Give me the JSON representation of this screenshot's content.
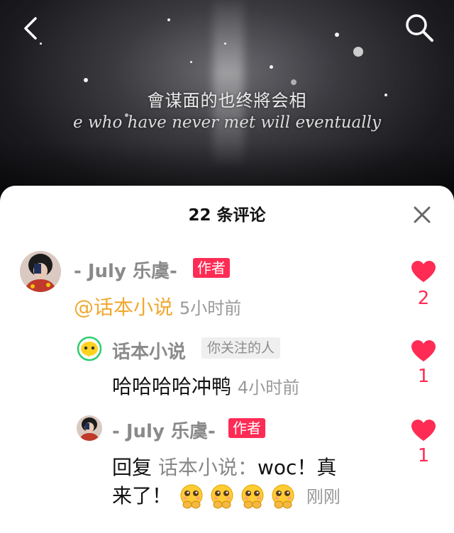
{
  "video": {
    "subtitle_cn": "會谋面的也终將会相",
    "subtitle_en": "e who have never met will eventually"
  },
  "header": {
    "back_icon": "chevron-left-icon",
    "search_icon": "search-icon"
  },
  "comments_panel": {
    "title": "22 条评论",
    "close_icon": "close-icon",
    "comments": [
      {
        "username": "- July 乐虞-",
        "badge": "作者",
        "mention": "@话本小说",
        "text": "",
        "time": "5小时前",
        "likes": "2"
      }
    ],
    "replies": [
      {
        "username": "话本小说",
        "badge": "你关注的人",
        "text": "哈哈哈哈冲鸭",
        "time": "4小时前",
        "likes": "1"
      },
      {
        "username": "- July 乐虞-",
        "badge": "作者",
        "reply_prefix": "回复",
        "reply_target": "话本小说：",
        "text_line1": "woc！真",
        "text_line2": "来了！",
        "emojis": [
          "pleading-face-emoji",
          "pleading-face-emoji",
          "pleading-face-emoji",
          "pleading-face-emoji"
        ],
        "time": "刚刚",
        "likes": "1"
      }
    ]
  },
  "colors": {
    "accent": "#fe2c55",
    "mention": "#f0a830",
    "meta": "#999999"
  }
}
